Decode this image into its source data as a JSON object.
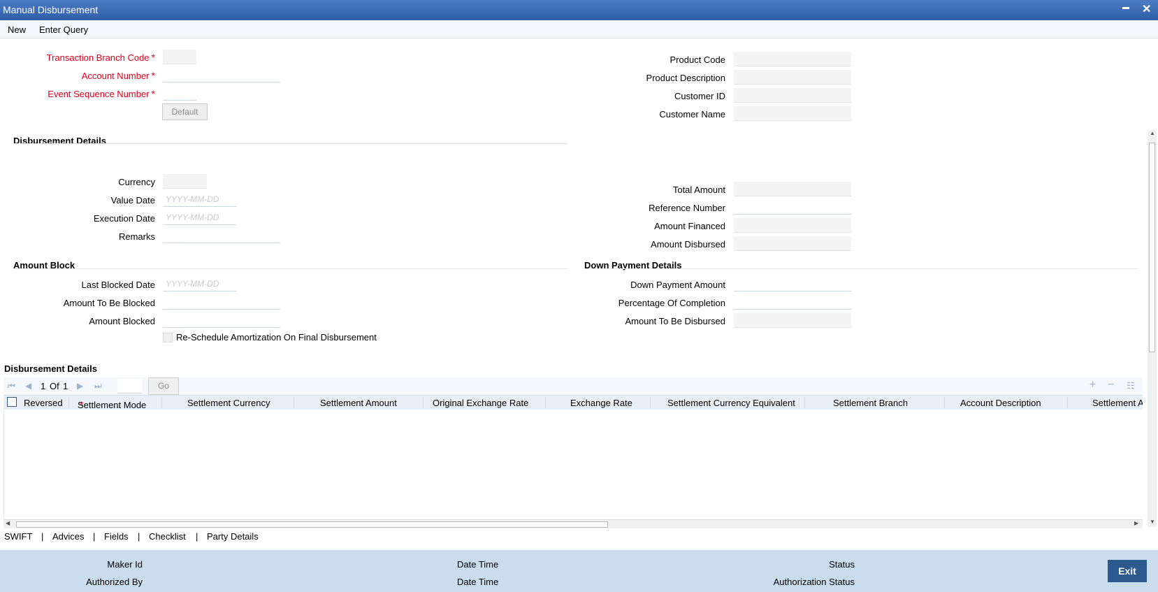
{
  "window": {
    "title": "Manual Disbursement",
    "minimize": "▬",
    "close": "✕"
  },
  "menu": {
    "new": "New",
    "enter_query": "Enter Query"
  },
  "header": {
    "transaction_branch_code": "Transaction Branch Code",
    "account_number": "Account Number",
    "event_sequence_number": "Event Sequence Number",
    "default_button": "Default",
    "product_code": "Product Code",
    "product_description": "Product Description",
    "customer_id": "Customer ID",
    "customer_name": "Customer Name",
    "required_mark": "*"
  },
  "disbursement": {
    "section_title": "Disbursement Details",
    "currency": "Currency",
    "value_date": "Value Date",
    "execution_date": "Execution Date",
    "remarks": "Remarks",
    "total_amount": "Total Amount",
    "reference_number": "Reference Number",
    "amount_financed": "Amount Financed",
    "amount_disbursed": "Amount Disbursed",
    "date_placeholder": "YYYY-MM-DD"
  },
  "amount_block": {
    "section_title": "Amount Block",
    "last_blocked_date": "Last Blocked Date",
    "amount_to_be_blocked": "Amount To Be Blocked",
    "amount_blocked": "Amount Blocked",
    "reschedule_label": "Re-Schedule Amortization On Final Disbursement"
  },
  "down_payment": {
    "section_title": "Down Payment Details",
    "down_payment_amount": "Down Payment Amount",
    "percentage_of_completion": "Percentage Of Completion",
    "amount_to_be_disbursed": "Amount To Be Disbursed"
  },
  "grid": {
    "section_title": "Disbursement Details",
    "page_current": "1",
    "page_of": "Of",
    "page_total": "1",
    "go": "Go",
    "columns": [
      "Reversed",
      "Settlement Mode",
      "Settlement Currency",
      "Settlement Amount",
      "Original Exchange Rate",
      "Exchange Rate",
      "Settlement Currency Equivalent",
      "Settlement Branch",
      "Account Description",
      "Settlement A"
    ]
  },
  "tabs": {
    "swift": "SWIFT",
    "advices": "Advices",
    "fields": "Fields",
    "checklist": "Checklist",
    "party_details": "Party Details",
    "sep": "|"
  },
  "footer": {
    "maker_id": "Maker Id",
    "date_time": "Date Time",
    "status": "Status",
    "authorized_by": "Authorized By",
    "authorization_status": "Authorization Status",
    "exit": "Exit"
  }
}
